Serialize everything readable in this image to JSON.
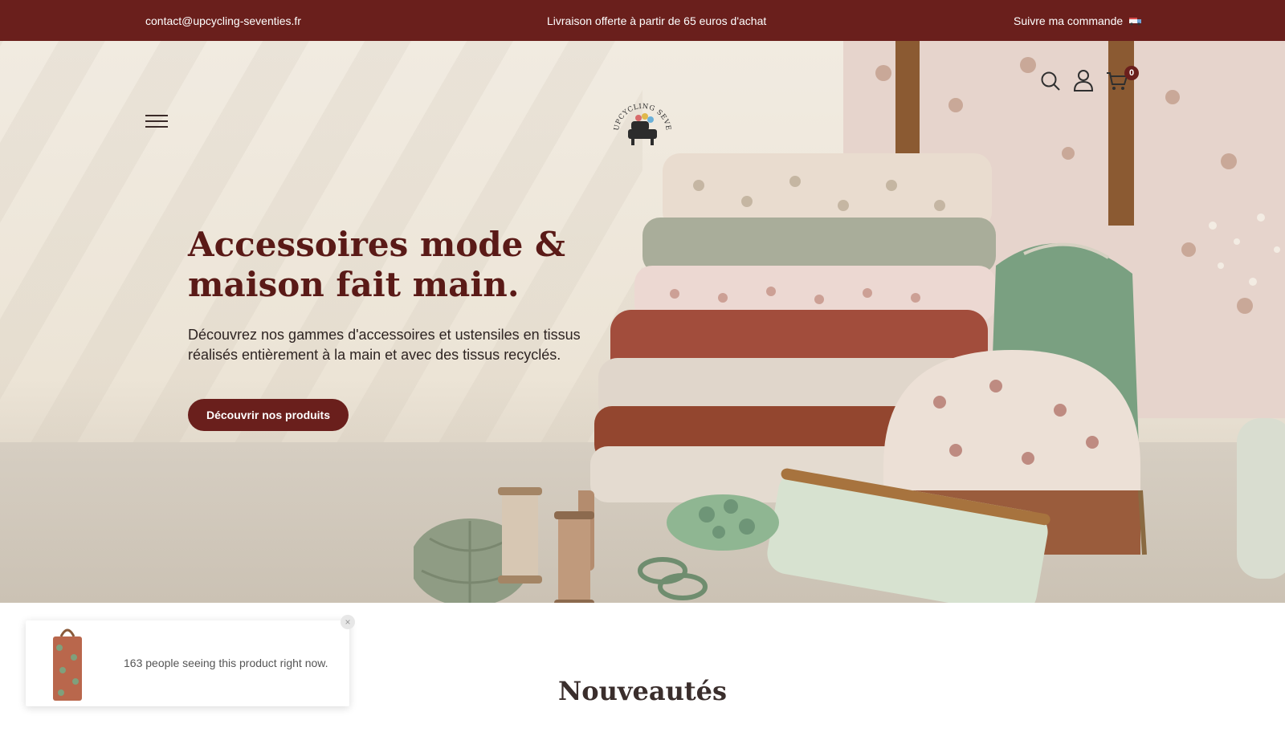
{
  "topbar": {
    "email": "contact@upcycling-seventies.fr",
    "shipping": "Livraison offerte à partir de 65 euros d'achat",
    "track_order": "Suivre ma commande"
  },
  "header": {
    "logo_text": "UPCYCLING SEVENTIES",
    "cart_count": "0"
  },
  "hero": {
    "title": "Accessoires mode & maison fait main.",
    "subtitle": "Découvrez nos gammes d'accessoires et ustensiles en tissus réalisés entièrement à la main et avec des tissus recyclés.",
    "cta_label": "Découvrir nos produits"
  },
  "popup": {
    "text": "163 people seeing this product right now.",
    "close_label": "×"
  },
  "sections": {
    "new_title": "Nouveautés"
  },
  "colors": {
    "brand": "#6a1f1c",
    "title": "#5a1a17"
  },
  "icons": [
    "menu-icon",
    "search-icon",
    "user-icon",
    "cart-icon",
    "truck-icon",
    "close-icon"
  ]
}
